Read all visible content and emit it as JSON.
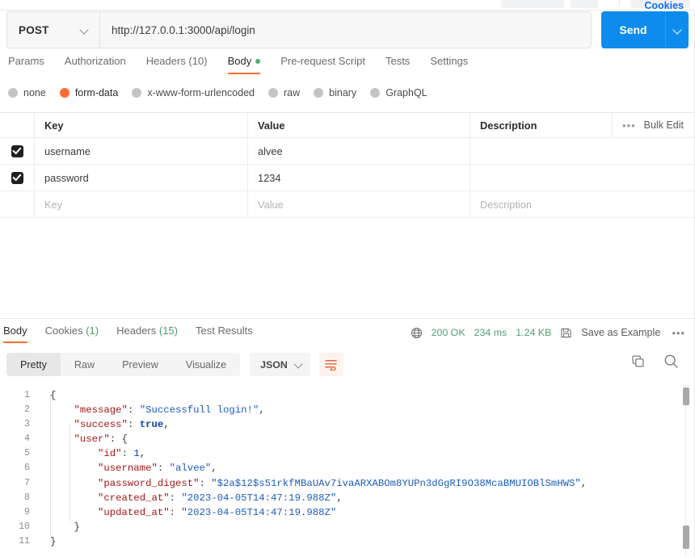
{
  "request": {
    "method": "POST",
    "url": "http://127.0.0.1:3000/api/login",
    "send_label": "Send",
    "tabs": [
      {
        "label": "Params",
        "active": false,
        "dot": false
      },
      {
        "label": "Authorization",
        "active": false,
        "dot": false
      },
      {
        "label": "Headers (10)",
        "active": false,
        "dot": false
      },
      {
        "label": "Body",
        "active": true,
        "dot": true
      },
      {
        "label": "Pre-request Script",
        "active": false,
        "dot": false
      },
      {
        "label": "Tests",
        "active": false,
        "dot": false
      },
      {
        "label": "Settings",
        "active": false,
        "dot": false
      }
    ],
    "cookies_link": "Cookies",
    "body_types": [
      {
        "label": "none",
        "selected": false
      },
      {
        "label": "form-data",
        "selected": true
      },
      {
        "label": "x-www-form-urlencoded",
        "selected": false
      },
      {
        "label": "raw",
        "selected": false
      },
      {
        "label": "binary",
        "selected": false
      },
      {
        "label": "GraphQL",
        "selected": false
      }
    ],
    "table": {
      "headers": {
        "key": "Key",
        "value": "Value",
        "description": "Description"
      },
      "bulk_edit": "Bulk Edit",
      "rows": [
        {
          "checked": true,
          "key": "username",
          "value": "alvee",
          "description": ""
        },
        {
          "checked": true,
          "key": "password",
          "value": "1234",
          "description": ""
        }
      ],
      "placeholder_row": {
        "key": "Key",
        "value": "Value",
        "description": "Description"
      }
    }
  },
  "response": {
    "tabs": [
      {
        "label": "Body",
        "count": "",
        "active": true
      },
      {
        "label": "Cookies",
        "count": "(1)",
        "active": false
      },
      {
        "label": "Headers",
        "count": "(15)",
        "active": false
      },
      {
        "label": "Test Results",
        "count": "",
        "active": false
      }
    ],
    "status": "200 OK",
    "time": "234 ms",
    "size": "1.24 KB",
    "save_as_example": "Save as Example",
    "format_tabs": [
      {
        "label": "Pretty",
        "active": true
      },
      {
        "label": "Raw",
        "active": false
      },
      {
        "label": "Preview",
        "active": false
      },
      {
        "label": "Visualize",
        "active": false
      }
    ],
    "language": "JSON",
    "code_lines": [
      {
        "n": "1",
        "tokens": [
          {
            "t": "{",
            "c": "pun"
          }
        ]
      },
      {
        "n": "2",
        "tokens": [
          {
            "t": "    \"message\"",
            "c": "key"
          },
          {
            "t": ": ",
            "c": "pun"
          },
          {
            "t": "\"Successfull login!\"",
            "c": "str"
          },
          {
            "t": ",",
            "c": "pun"
          }
        ]
      },
      {
        "n": "3",
        "tokens": [
          {
            "t": "    \"success\"",
            "c": "key"
          },
          {
            "t": ": ",
            "c": "pun"
          },
          {
            "t": "true",
            "c": "bool"
          },
          {
            "t": ",",
            "c": "pun"
          }
        ]
      },
      {
        "n": "4",
        "tokens": [
          {
            "t": "    \"user\"",
            "c": "key"
          },
          {
            "t": ": ",
            "c": "pun"
          },
          {
            "t": "{",
            "c": "pun"
          }
        ]
      },
      {
        "n": "5",
        "tokens": [
          {
            "t": "        \"id\"",
            "c": "key"
          },
          {
            "t": ": ",
            "c": "pun"
          },
          {
            "t": "1",
            "c": "num"
          },
          {
            "t": ",",
            "c": "pun"
          }
        ]
      },
      {
        "n": "6",
        "tokens": [
          {
            "t": "        \"username\"",
            "c": "key"
          },
          {
            "t": ": ",
            "c": "pun"
          },
          {
            "t": "\"alvee\"",
            "c": "str"
          },
          {
            "t": ",",
            "c": "pun"
          }
        ]
      },
      {
        "n": "7",
        "tokens": [
          {
            "t": "        \"password_digest\"",
            "c": "key"
          },
          {
            "t": ": ",
            "c": "pun"
          },
          {
            "t": "\"$2a$12$s51rkfMBaUAv7ivaARXABOm8YUPn3dGgRI9O38McaBMUIOBlSmHWS\"",
            "c": "str"
          },
          {
            "t": ",",
            "c": "pun"
          }
        ]
      },
      {
        "n": "8",
        "tokens": [
          {
            "t": "        \"created_at\"",
            "c": "key"
          },
          {
            "t": ": ",
            "c": "pun"
          },
          {
            "t": "\"2023-04-05T14:47:19.988Z\"",
            "c": "str"
          },
          {
            "t": ",",
            "c": "pun"
          }
        ]
      },
      {
        "n": "9",
        "tokens": [
          {
            "t": "        \"updated_at\"",
            "c": "key"
          },
          {
            "t": ": ",
            "c": "pun"
          },
          {
            "t": "\"2023-04-05T14:47:19.988Z\"",
            "c": "str"
          }
        ]
      },
      {
        "n": "10",
        "tokens": [
          {
            "t": "    }",
            "c": "pun"
          }
        ]
      },
      {
        "n": "11",
        "tokens": [
          {
            "t": "}",
            "c": "pun"
          }
        ]
      }
    ]
  },
  "colors": {
    "accent_orange": "#ff6c37",
    "send_blue": "#0d8ced",
    "status_green": "#4f9f72",
    "link_blue": "#0d6efd"
  }
}
